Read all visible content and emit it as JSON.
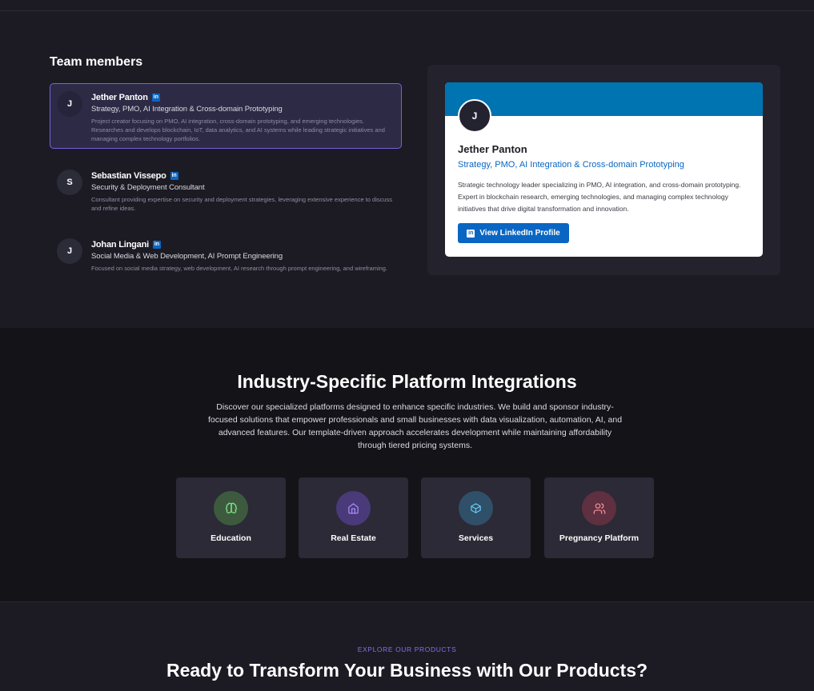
{
  "team": {
    "heading": "Team members",
    "members": [
      {
        "initial": "J",
        "name": "Jether Panton",
        "role": "Strategy, PMO, AI Integration & Cross-domain Prototyping",
        "description": "Project creator focusing on PMO, AI integration, cross-domain prototyping, and emerging technologies. Researches and develops blockchain, IoT, data analytics, and AI systems while leading strategic initiatives and managing complex technology portfolios."
      },
      {
        "initial": "S",
        "name": "Sebastian Vissepo",
        "role": "Security & Deployment Consultant",
        "description": "Consultant providing expertise on security and deployment strategies, leveraging extensive experience to discuss and refine ideas."
      },
      {
        "initial": "J",
        "name": "Johan Lingani",
        "role": "Social Media & Web Development, AI Prompt Engineering",
        "description": "Focused on social media strategy, web development, AI research through prompt engineering, and wireframing."
      }
    ],
    "linkedin_mini": "in"
  },
  "profile": {
    "initial": "J",
    "name": "Jether Panton",
    "role": "Strategy, PMO, AI Integration & Cross-domain Prototyping",
    "description": "Strategic technology leader specializing in PMO, AI integration, and cross-domain prototyping. Expert in blockchain research, emerging technologies, and managing complex technology initiatives that drive digital transformation and innovation.",
    "button_label": "View LinkedIn Profile",
    "button_icon": "in"
  },
  "industry": {
    "title": "Industry-Specific Platform Integrations",
    "description": "Discover our specialized platforms designed to enhance specific industries. We build and sponsor industry-focused solutions that empower professionals and small businesses with data visualization, automation, AI, and advanced features. Our template-driven approach accelerates development while maintaining affordability through tiered pricing systems.",
    "cards": [
      {
        "label": "Education",
        "icon": "brain-icon",
        "bg": "#3d5a3f",
        "fg": "#7ddc82"
      },
      {
        "label": "Real Estate",
        "icon": "home-icon",
        "bg": "#4a3a7a",
        "fg": "#a78bfa"
      },
      {
        "label": "Services",
        "icon": "box-icon",
        "bg": "#2f5068",
        "fg": "#67c7f0"
      },
      {
        "label": "Pregnancy Platform",
        "icon": "users-icon",
        "bg": "#5e3040",
        "fg": "#f08a96"
      }
    ]
  },
  "products": {
    "eyebrow": "EXPLORE OUR PRODUCTS",
    "title": "Ready to Transform Your Business with Our Products?"
  },
  "colors": {
    "accent_purple": "#7b5fe0",
    "linkedin_blue": "#0a66c2",
    "banner_blue": "#0073b1"
  }
}
